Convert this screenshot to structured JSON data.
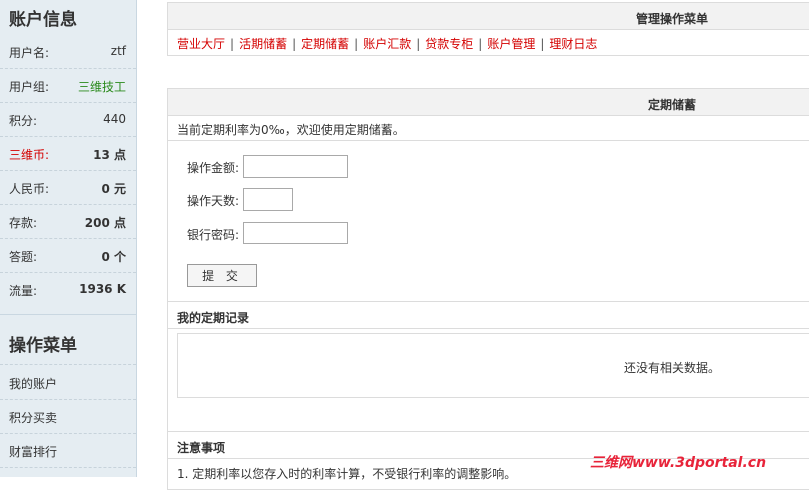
{
  "sidebar": {
    "account_title": "账户信息",
    "rows": [
      {
        "label": "用户名:",
        "value": "ztf"
      },
      {
        "label": "用户组:",
        "value": "三维技工"
      },
      {
        "label": "积分:",
        "value": "440"
      },
      {
        "label": "三维币:",
        "value": "13 点"
      },
      {
        "label": "人民币:",
        "value": "0 元"
      },
      {
        "label": "存款:",
        "value": "200 点"
      },
      {
        "label": "答题:",
        "value": "0 个"
      },
      {
        "label": "流量:",
        "value": "1936 K"
      }
    ],
    "menu_title": "操作菜单",
    "menu": [
      "我的账户",
      "积分买卖",
      "财富排行"
    ]
  },
  "top_panel": {
    "title": "管理操作菜单",
    "links": [
      "营业大厅",
      "活期储蓄",
      "定期储蓄",
      "账户汇款",
      "贷款专柜",
      "账户管理",
      "理财日志"
    ]
  },
  "deposit_panel": {
    "title": "定期储蓄",
    "notice": "当前定期利率为0‰，欢迎使用定期储蓄。",
    "amount_label": "操作金额:",
    "days_label": "操作天数:",
    "password_label": "银行密码:",
    "submit_label": "提 交"
  },
  "records": {
    "title": "我的定期记录",
    "empty_text": "还没有相关数据。"
  },
  "notes": {
    "title": "注意事项",
    "item1": "1. 定期利率以您存入时的利率计算，不受银行利率的调整影响。"
  },
  "watermark": "三维网www.3dportal.cn",
  "colors": {
    "link_red": "#d40000",
    "group_green": "#2a8a1c",
    "sidebar_bg": "#e5edf2"
  }
}
